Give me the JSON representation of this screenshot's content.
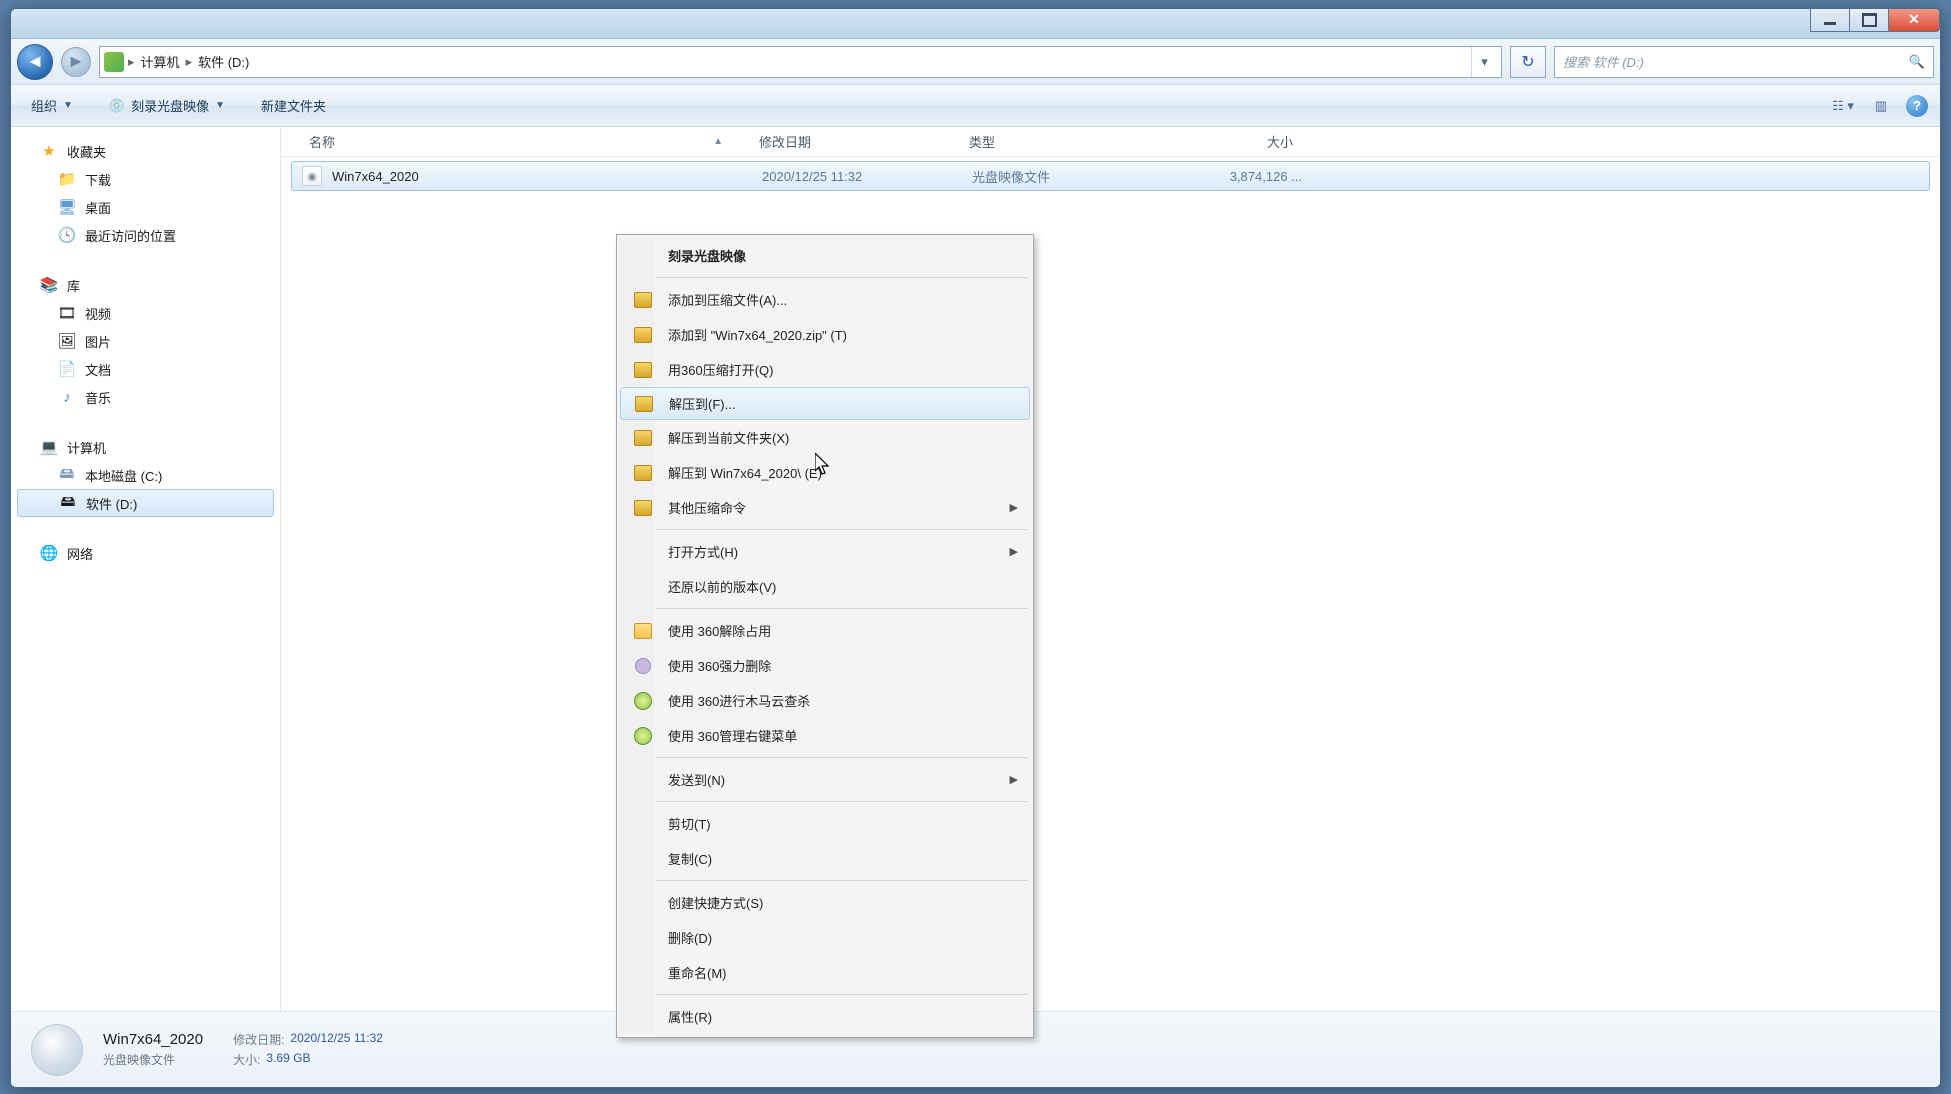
{
  "breadcrumb": {
    "part1": "计算机",
    "part2": "软件 (D:)"
  },
  "search": {
    "placeholder": "搜索 软件 (D:)"
  },
  "toolbar": {
    "organize": "组织",
    "burn": "刻录光盘映像",
    "new_folder": "新建文件夹"
  },
  "columns": {
    "name": "名称",
    "date": "修改日期",
    "type": "类型",
    "size": "大小"
  },
  "sidebar": {
    "favorites": "收藏夹",
    "downloads": "下载",
    "desktop": "桌面",
    "recent": "最近访问的位置",
    "libraries": "库",
    "videos": "视频",
    "pictures": "图片",
    "documents": "文档",
    "music": "音乐",
    "computer": "计算机",
    "local_c": "本地磁盘 (C:)",
    "software_d": "软件 (D:)",
    "network": "网络"
  },
  "file": {
    "name": "Win7x64_2020",
    "date": "2020/12/25 11:32",
    "type": "光盘映像文件",
    "size": "3,874,126 ..."
  },
  "context_menu": {
    "burn_image": "刻录光盘映像",
    "add_archive": "添加到压缩文件(A)...",
    "add_zip": "添加到 \"Win7x64_2020.zip\" (T)",
    "open_360zip": "用360压缩打开(Q)",
    "extract_to": "解压到(F)...",
    "extract_here": "解压到当前文件夹(X)",
    "extract_folder": "解压到 Win7x64_2020\\ (E)",
    "other_zip": "其他压缩命令",
    "open_with": "打开方式(H)",
    "restore_prev": "还原以前的版本(V)",
    "unlock_360": "使用 360解除占用",
    "force_del_360": "使用 360强力删除",
    "scan_360": "使用 360进行木马云查杀",
    "manage_menu_360": "使用 360管理右键菜单",
    "send_to": "发送到(N)",
    "cut": "剪切(T)",
    "copy": "复制(C)",
    "create_shortcut": "创建快捷方式(S)",
    "delete": "删除(D)",
    "rename": "重命名(M)",
    "properties": "属性(R)"
  },
  "details": {
    "name": "Win7x64_2020",
    "type": "光盘映像文件",
    "date_label": "修改日期:",
    "date_value": "2020/12/25 11:32",
    "size_label": "大小:",
    "size_value": "3.69 GB"
  }
}
